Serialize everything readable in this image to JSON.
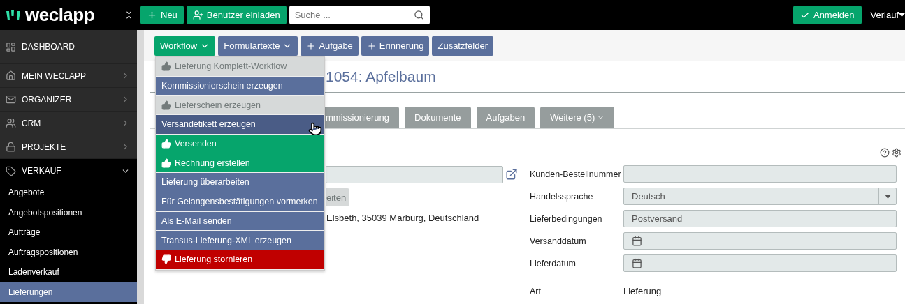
{
  "topbar": {
    "logo": "weclapp",
    "buttons": [
      {
        "kind": "new",
        "label": "Neu"
      },
      {
        "kind": "invite",
        "label": "Benutzer einladen"
      }
    ],
    "search": {
      "placeholder": "Suche ..."
    },
    "login": "Anmelden",
    "history": "Verlauf"
  },
  "sidebar": {
    "items": [
      {
        "kind": "dashboard",
        "label": "DASHBOARD",
        "expanded": false
      },
      {
        "kind": "home",
        "label": "MEIN WECLAPP",
        "expanded": false
      },
      {
        "kind": "mail",
        "label": "ORGANIZER",
        "expanded": false
      },
      {
        "kind": "users",
        "label": "CRM",
        "expanded": false
      },
      {
        "kind": "lock",
        "label": "PROJEKTE",
        "expanded": false
      },
      {
        "kind": "tag",
        "label": "VERKAUF",
        "expanded": true,
        "children": [
          {
            "label": "Angebote",
            "selected": false
          },
          {
            "label": "Angebotspositionen",
            "selected": false
          },
          {
            "label": "Aufträge",
            "selected": false
          },
          {
            "label": "Auftragspositionen",
            "selected": false
          },
          {
            "label": "Ladenverkauf",
            "selected": false
          },
          {
            "label": "Lieferungen",
            "selected": true
          }
        ]
      }
    ]
  },
  "toolbar": [
    {
      "kind": "menu",
      "label": "Workflow",
      "color": "#06a56c"
    },
    {
      "kind": "menu",
      "label": "Formulartexte",
      "color": "#5a6f9c"
    },
    {
      "kind": "add",
      "label": "Aufgabe",
      "color": "#5a6f9c"
    },
    {
      "kind": "add",
      "label": "Erinnerung",
      "color": "#5a6f9c"
    },
    {
      "kind": "plain",
      "label": "Zusatzfelder",
      "color": "#5a6f9c"
    }
  ],
  "workflow_menu": [
    {
      "kind": "disabled",
      "label": "Lieferung Komplett-Workflow",
      "hovered": false
    },
    {
      "kind": "action",
      "label": "Kommissionierschein erzeugen",
      "hovered": false
    },
    {
      "kind": "disabled",
      "label": "Lieferschein erzeugen",
      "hovered": false
    },
    {
      "kind": "action",
      "label": "Versandetikett erzeugen",
      "hovered": true
    },
    {
      "kind": "positive",
      "label": "Versenden",
      "hovered": false
    },
    {
      "kind": "positive",
      "label": "Rechnung erstellen",
      "hovered": false
    },
    {
      "kind": "action",
      "label": "Lieferung überarbeiten",
      "hovered": false
    },
    {
      "kind": "action",
      "label": "Für Gelangensbestätigungen vormerken",
      "hovered": false
    },
    {
      "kind": "action",
      "label": "Als E-Mail senden",
      "hovered": false
    },
    {
      "kind": "action",
      "label": "Transus-Lieferung-XML erzeugen",
      "hovered": false
    },
    {
      "kind": "negative",
      "label": "Lieferung stornieren",
      "hovered": false
    }
  ],
  "title": "1054: Apfelbaum",
  "tabs": [
    {
      "label": "mmissionierung",
      "selected": false,
      "dropdown": false
    },
    {
      "label": "Dokumente",
      "selected": false,
      "dropdown": false
    },
    {
      "label": "Aufgaben",
      "selected": false,
      "dropdown": false
    },
    {
      "label": "Weitere (5)",
      "selected": false,
      "dropdown": true
    }
  ],
  "left_form": {
    "button": "eiten",
    "address": "Elsbeth, 35039 Marburg, Deutschland"
  },
  "right_form": [
    {
      "kind": "text",
      "label": "Kunden-Bestellnummer"
    },
    {
      "kind": "select",
      "label": "Handelssprache",
      "value": "Deutsch"
    },
    {
      "kind": "text",
      "label": "Lieferbedingungen",
      "value": "Postversand"
    },
    {
      "kind": "date",
      "label": "Versanddatum"
    },
    {
      "kind": "date",
      "label": "Lieferdatum"
    },
    {
      "kind": "static",
      "label": "Art",
      "value": "Lieferung"
    }
  ]
}
